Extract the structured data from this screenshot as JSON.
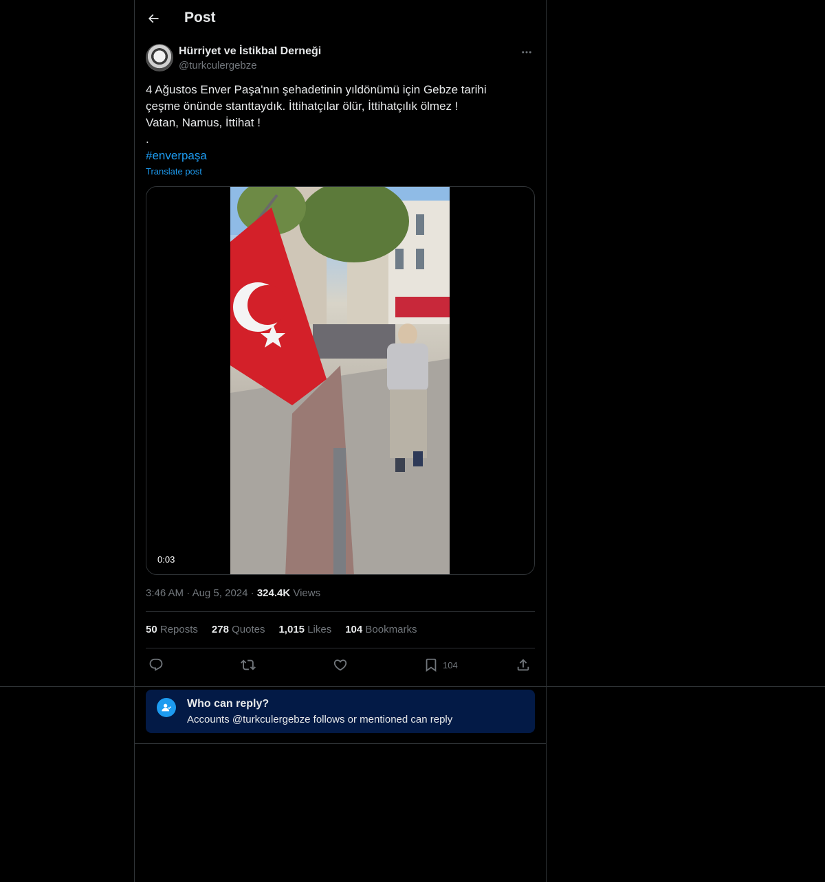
{
  "header": {
    "title": "Post",
    "back_icon": "arrow-left-icon"
  },
  "author": {
    "name": "Hürriyet ve İstikbal Derneği",
    "handle": "@turkculergebze"
  },
  "post": {
    "lines": [
      "4 Ağustos Enver Paşa'nın şehadetinin yıldönümü için Gebze tarihi",
      "çeşme önünde stanttaydık. İttihatçılar ölür, İttihatçılık ölmez !",
      "Vatan, Namus, İttihat !",
      "."
    ],
    "hashtag": "#enverpaşa",
    "translate_label": "Translate post"
  },
  "media": {
    "duration": "0:03"
  },
  "meta": {
    "time": "3:46 AM",
    "dot1": "·",
    "date": "Aug 5, 2024",
    "dot2": "·",
    "views_count": "324.4K",
    "views_label": "Views"
  },
  "stats": {
    "reposts_count": "50",
    "reposts_label": "Reposts",
    "quotes_count": "278",
    "quotes_label": "Quotes",
    "likes_count": "1,015",
    "likes_label": "Likes",
    "bookmarks_count": "104",
    "bookmarks_label": "Bookmarks"
  },
  "actions": {
    "bookmark_count": "104"
  },
  "reply_settings": {
    "title": "Who can reply?",
    "subtitle": "Accounts @turkculergebze follows or mentioned can reply"
  },
  "colors": {
    "accent": "#1d9bf0",
    "background": "#000000",
    "reply_box": "#031a46"
  }
}
